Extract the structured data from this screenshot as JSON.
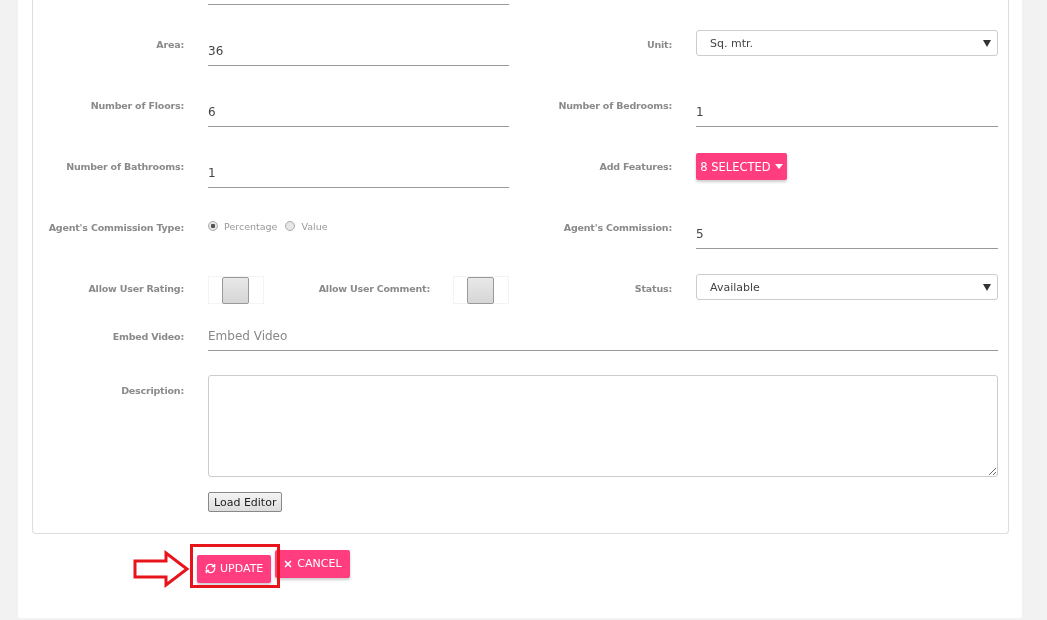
{
  "form": {
    "rows": [
      {
        "cells": [
          {
            "label": "Area:",
            "field": {
              "kind": "text",
              "value": "36"
            }
          },
          {
            "label": "Unit:",
            "field": {
              "kind": "select",
              "value": "Sq. mtr."
            }
          }
        ]
      },
      {
        "cells": [
          {
            "label": "Number of Floors:",
            "field": {
              "kind": "text",
              "value": "6"
            }
          },
          {
            "label": "Number of Bedrooms:",
            "field": {
              "kind": "text",
              "value": "1"
            }
          }
        ]
      },
      {
        "cells": [
          {
            "label": "Number of Bathrooms:",
            "field": {
              "kind": "text",
              "value": "1"
            }
          },
          {
            "label": "Add Features:",
            "field": {
              "kind": "multiselect",
              "value": "8 SELECTED"
            }
          }
        ]
      },
      {
        "cells": [
          {
            "label": "Agent's Commission Type:",
            "field": {
              "kind": "radio",
              "options": [
                {
                  "label": "Percentage",
                  "selected": true
                },
                {
                  "label": "Value",
                  "selected": false
                }
              ]
            }
          },
          {
            "label": "Agent's Commission:",
            "field": {
              "kind": "text",
              "value": "5"
            }
          }
        ]
      },
      {
        "cells": [
          {
            "label": "Allow User Rating:",
            "field": {
              "kind": "toggle",
              "on": false
            },
            "extra": {
              "label": "Allow User Comment:",
              "on": false
            }
          },
          {
            "label": "Status:",
            "field": {
              "kind": "select",
              "value": "Available"
            }
          }
        ]
      }
    ],
    "embed_video": {
      "label": "Embed Video:",
      "placeholder": "Embed Video"
    },
    "description": {
      "label": "Description:",
      "button": "Load Editor"
    }
  },
  "actions": {
    "update": "UPDATE",
    "cancel": "CANCEL"
  }
}
